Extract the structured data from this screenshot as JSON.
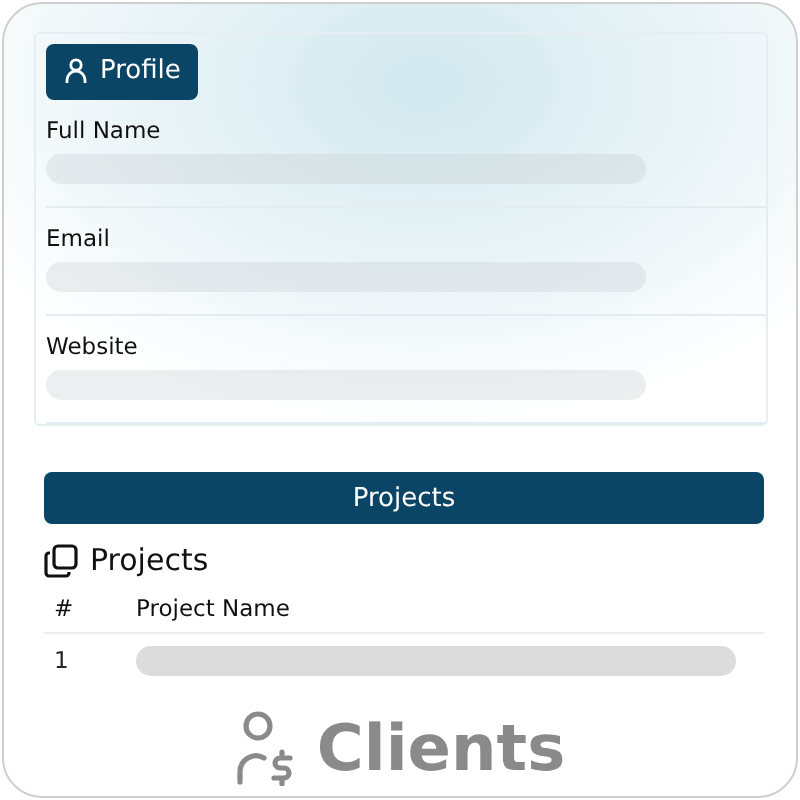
{
  "profile_tab": {
    "label": "Profile"
  },
  "fields": [
    {
      "label": "Full Name"
    },
    {
      "label": "Email"
    },
    {
      "label": "Website"
    }
  ],
  "projects_button": {
    "label": "Projects"
  },
  "projects": {
    "title": "Projects",
    "columns": [
      "#",
      "Project Name"
    ],
    "rows": [
      {
        "number": "1"
      }
    ]
  },
  "footer": {
    "label": "Clients"
  }
}
